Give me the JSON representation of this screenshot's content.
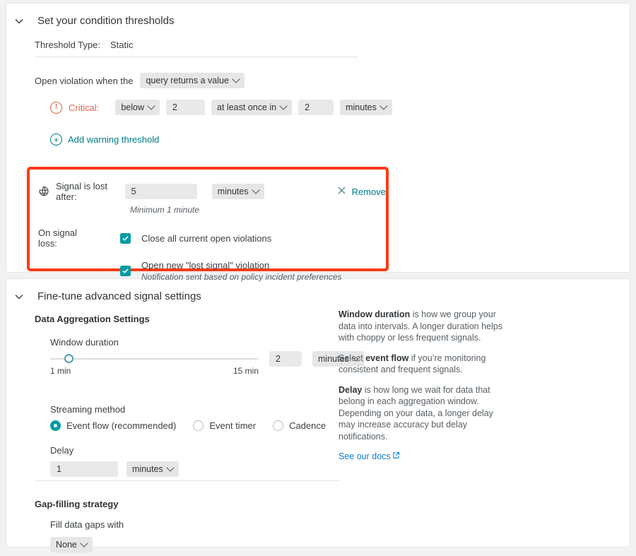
{
  "thresholds": {
    "title": "Set your condition thresholds",
    "chevron_icon": "chevron-down-icon",
    "threshold_type_label": "Threshold Type:",
    "threshold_type_value": "Static",
    "open_violation_label": "Open violation when the",
    "open_violation_select": "query returns a value",
    "critical": {
      "icon": "alert-circle-icon",
      "label": "Critical:",
      "operator": "below",
      "value": "2",
      "frequency": "at least once in",
      "duration": "2",
      "duration_unit": "minutes"
    },
    "add_warning_label": "Add warning threshold",
    "add_warning_icon": "plus-circle-icon"
  },
  "signal_loss": {
    "icon": "signal-lost-globe-icon",
    "label": "Signal is lost after:",
    "value": "5",
    "unit": "minutes",
    "minimum_note": "Minimum 1 minute",
    "remove_label": "Remove",
    "remove_icon": "close-x-icon",
    "on_signal_loss_label": "On signal loss:",
    "close_violations_label": "Close all current open violations",
    "close_violations_checked": true,
    "open_lost_signal_label": "Open new \"lost signal\" violation",
    "open_lost_signal_checked": true,
    "open_lost_signal_note": "Notification sent based on policy incident preferences",
    "highlight_color": "#fc3b16"
  },
  "advanced": {
    "title": "Fine-tune advanced signal settings",
    "chevron_icon": "chevron-down-icon",
    "aggregation_heading": "Data Aggregation Settings",
    "window_duration_label": "Window duration",
    "window_duration_min_tick": "1 min",
    "window_duration_max_tick": "15 min",
    "window_duration_value": "2",
    "window_duration_unit": "minutes",
    "window_duration_range": [
      1,
      15
    ],
    "streaming_method_label": "Streaming method",
    "streaming_options": [
      {
        "label": "Event flow (recommended)",
        "selected": true
      },
      {
        "label": "Event timer",
        "selected": false
      },
      {
        "label": "Cadence",
        "selected": false
      }
    ],
    "delay_label": "Delay",
    "delay_value": "1",
    "delay_unit": "minutes",
    "gap_filling_heading": "Gap-filling strategy",
    "fill_gaps_label": "Fill data gaps with",
    "fill_gaps_value": "None"
  },
  "help": {
    "p1_bold": "Window duration",
    "p1_rest": " is how we group your data into intervals. A longer duration helps with choppy or less frequent signals.",
    "p2_pre": "Select ",
    "p2_bold": "event flow",
    "p2_rest": " if you’re monitoring consistent and frequent signals.",
    "p3_bold": "Delay",
    "p3_rest": " is how long we wait for data that belong in each aggregation window. Depending on your data, a longer delay may increase accuracy but delay notifications.",
    "docs_link": "See our docs",
    "docs_icon": "external-link-icon"
  },
  "colors": {
    "teal": "#007e8a",
    "teal_control": "#009ba4",
    "critical_red": "#e8604c",
    "highlight_red": "#fc3b16",
    "blue_link": "#0d7fd4"
  }
}
